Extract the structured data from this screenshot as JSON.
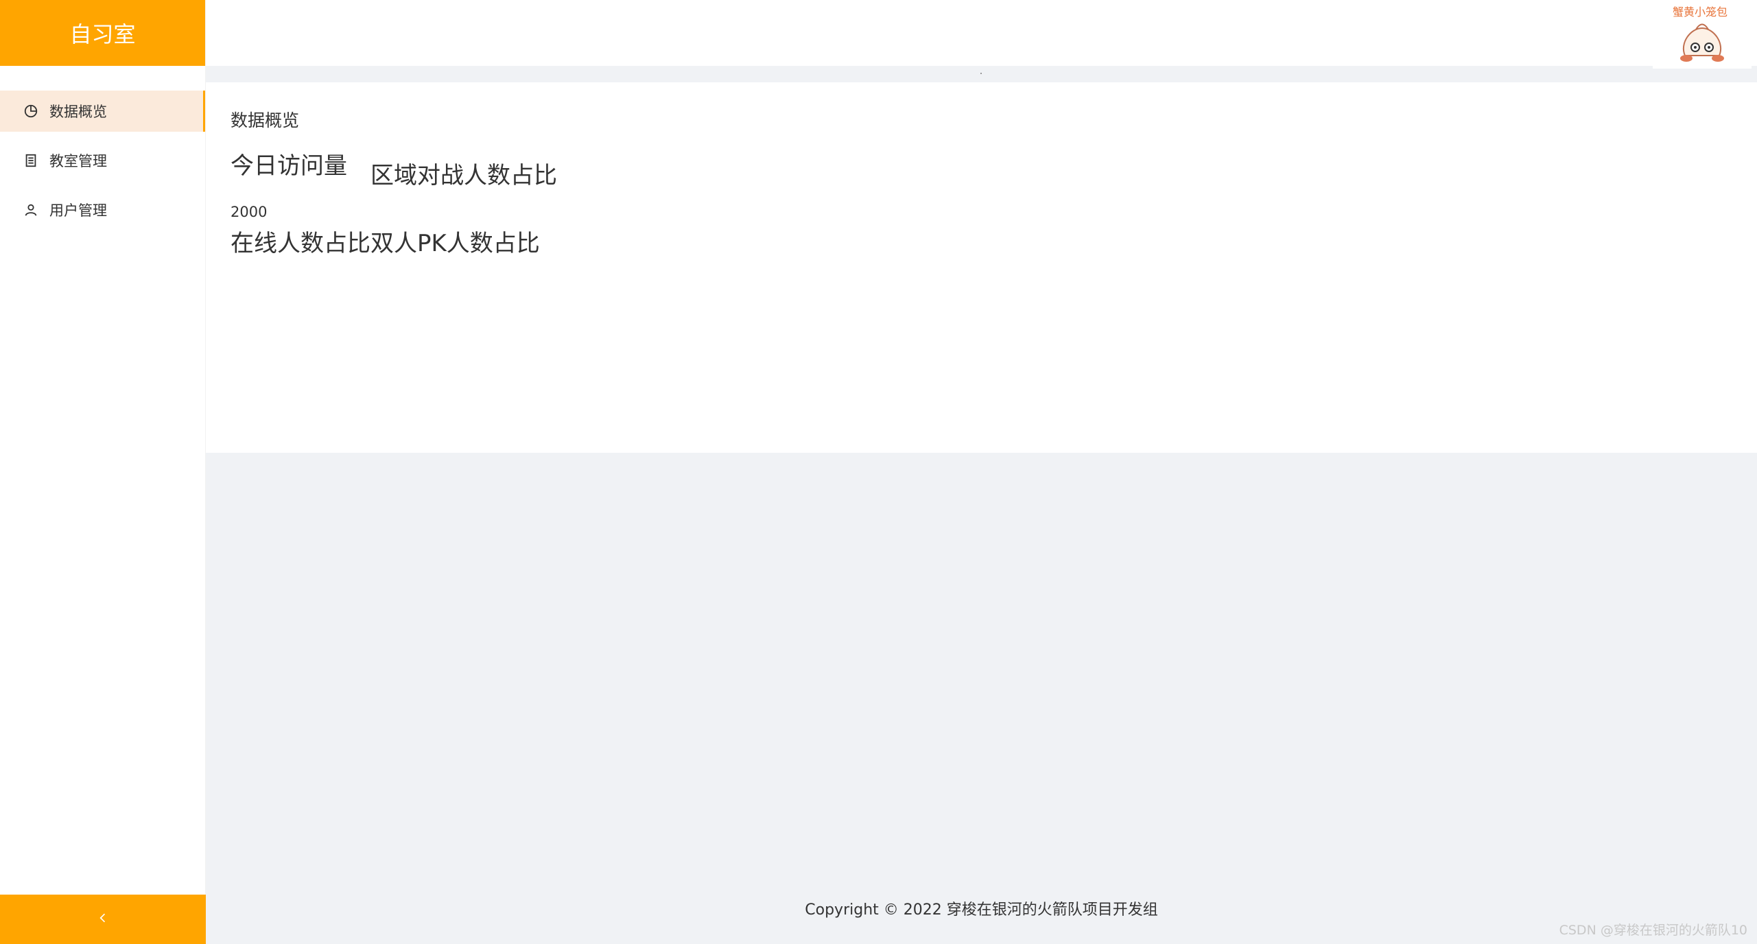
{
  "sidebar": {
    "title": "自习室",
    "items": [
      {
        "label": "数据概览",
        "icon": "pie-chart-icon",
        "active": true
      },
      {
        "label": "教室管理",
        "icon": "document-icon",
        "active": false
      },
      {
        "label": "用户管理",
        "icon": "user-icon",
        "active": false
      }
    ],
    "collapse_icon": "chevron-left-icon"
  },
  "header": {
    "avatar_icon": "mascot-avatar",
    "avatar_text": "蟹黄小笼包"
  },
  "main": {
    "card_title": "数据概览",
    "today_visits_label": "今日访问量",
    "today_visits_value": "2000",
    "region_battle_label": "区域对战人数占比",
    "online_ratio_label": "在线人数占比",
    "pk_ratio_label": "双人PK人数占比"
  },
  "footer": {
    "copyright": "Copyright © 2022 穿梭在银河的火箭队项目开发组"
  },
  "watermark": "CSDN @穿梭在银河的火箭队10",
  "colors": {
    "accent": "#ffa500",
    "active_bg": "#fbeadb",
    "page_bg": "#f0f2f5"
  }
}
